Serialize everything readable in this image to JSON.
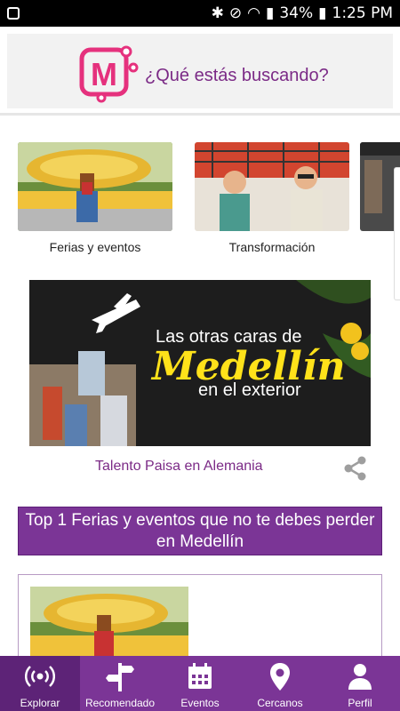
{
  "status_bar": {
    "time": "1:25 PM",
    "battery": "34%"
  },
  "header": {
    "search_placeholder": "¿Qué estás buscando?",
    "logo_letter": "M"
  },
  "categories": [
    {
      "label": "Ferias y eventos"
    },
    {
      "label": "Transformación"
    },
    {
      "label": ""
    }
  ],
  "featured": {
    "banner_line1": "Las otras caras de",
    "banner_line2": "Medellín",
    "banner_line3": "en el exterior",
    "caption": "Talento Paisa en Alemania"
  },
  "section": {
    "title": "Top 1 Ferias y eventos que no te debes perder en Medellín"
  },
  "bottom_nav": [
    {
      "label": "Explorar",
      "icon": "broadcast-icon"
    },
    {
      "label": "Recomendado",
      "icon": "signpost-icon"
    },
    {
      "label": "Eventos",
      "icon": "calendar-icon"
    },
    {
      "label": "Cercanos",
      "icon": "location-pin-icon"
    },
    {
      "label": "Perfil",
      "icon": "person-icon"
    }
  ],
  "colors": {
    "brand_purple": "#7b3596",
    "accent_pink": "#e5317d",
    "text_purple": "#7b2a86"
  }
}
